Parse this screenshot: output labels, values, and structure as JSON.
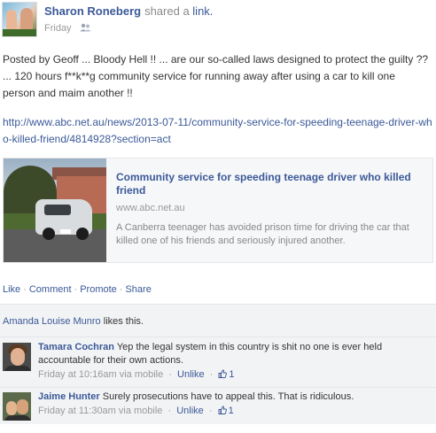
{
  "post": {
    "author": "Sharon Roneberg",
    "action": "shared a",
    "action_link": "link.",
    "time": "Friday",
    "text": "Posted by Geoff ... Bloody Hell !! ... are our so-called laws designed to protect the guilty ?? ... 120 hours f**k**g community service for running away after using a car to kill one person and maim another !!",
    "url": "http://www.abc.net.au/news/2013-07-11/community-service-for-speeding-teenage-driver-who-killed-friend/4814928?section=act"
  },
  "share_card": {
    "title": "Community service for speeding teenage driver who killed friend",
    "domain": "www.abc.net.au",
    "description": "A Canberra teenager has avoided prison time for driving the car that killed one of his friends and seriously injured another."
  },
  "actions": {
    "like": "Like",
    "comment": "Comment",
    "promote": "Promote",
    "share": "Share",
    "separator": "·"
  },
  "likes": {
    "name": "Amanda Louise Munro",
    "suffix": "likes this."
  },
  "comments": [
    {
      "name": "Tamara Cochran",
      "text": "Yep the legal system in this country is shit no one is ever held accountable for their own actions.",
      "time": "Friday at 10:16am via mobile",
      "unlike": "Unlike",
      "like_count": "1"
    },
    {
      "name": "Jaime Hunter",
      "text": "Surely prosecutions have to appeal this. That is ridiculous.",
      "time": "Friday at 11:30am via mobile",
      "unlike": "Unlike",
      "like_count": "1"
    }
  ],
  "colors": {
    "link": "#3b5998",
    "meta": "#999999",
    "ufi_background": "#f2f3f5"
  },
  "icons": {
    "audience": "friends-icon",
    "like": "thumbs-up-icon"
  }
}
